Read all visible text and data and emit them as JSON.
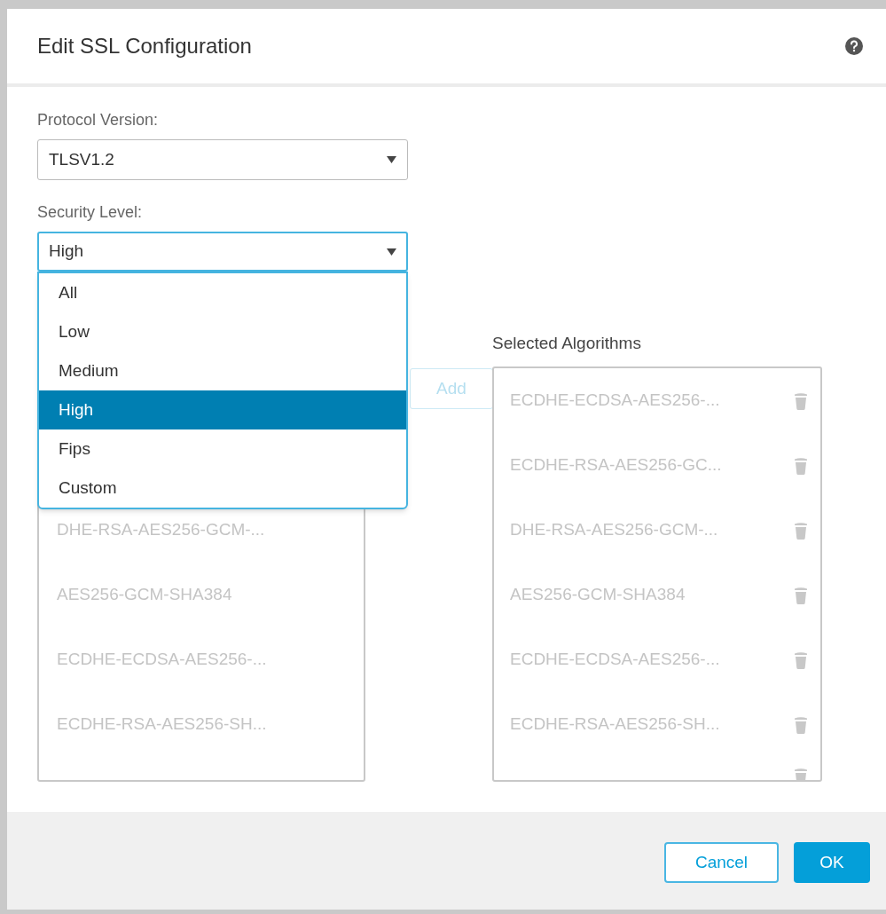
{
  "dialog": {
    "title": "Edit SSL Configuration"
  },
  "protocol_version": {
    "label": "Protocol Version:",
    "value": "TLSV1.2"
  },
  "security_level": {
    "label": "Security Level:",
    "value": "High",
    "expanded": true,
    "options": [
      {
        "label": "All",
        "selected": false
      },
      {
        "label": "Low",
        "selected": false
      },
      {
        "label": "Medium",
        "selected": false
      },
      {
        "label": "High",
        "selected": true
      },
      {
        "label": "Fips",
        "selected": false
      },
      {
        "label": "Custom",
        "selected": false
      }
    ]
  },
  "available_algorithms": {
    "items": [
      "DHE-RSA-AES256-GCM-...",
      "AES256-GCM-SHA384",
      "ECDHE-ECDSA-AES256-...",
      "ECDHE-RSA-AES256-SH..."
    ]
  },
  "add_button": {
    "label": "Add",
    "disabled": true
  },
  "selected_algorithms": {
    "label": "Selected Algorithms",
    "items": [
      "ECDHE-ECDSA-AES256-...",
      "ECDHE-RSA-AES256-GC...",
      "DHE-RSA-AES256-GCM-...",
      "AES256-GCM-SHA384",
      "ECDHE-ECDSA-AES256-...",
      "ECDHE-RSA-AES256-SH..."
    ]
  },
  "buttons": [
    {
      "label": "Cancel",
      "kind": "secondary"
    },
    {
      "label": "OK",
      "kind": "primary"
    }
  ]
}
